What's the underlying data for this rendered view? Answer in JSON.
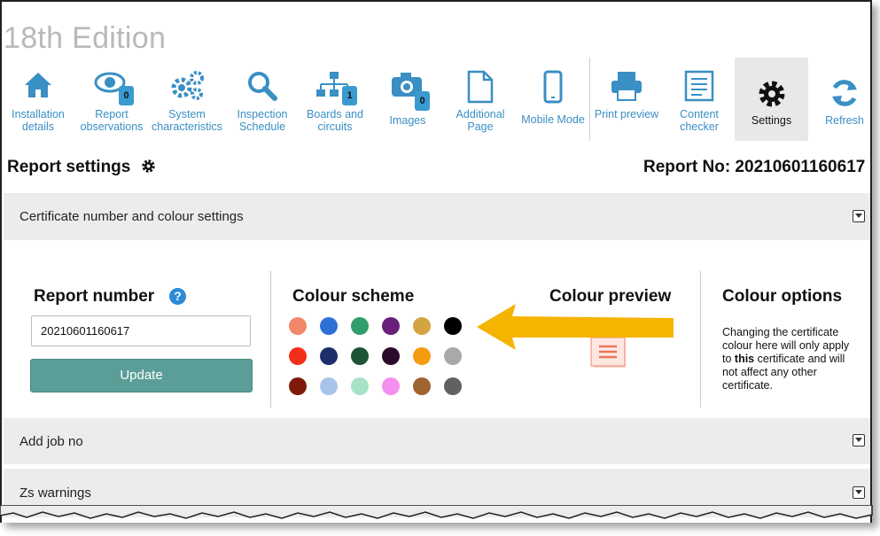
{
  "app": {
    "edition": "18th Edition"
  },
  "toolbar": {
    "items": [
      {
        "id": "installation",
        "label": "Installation details",
        "icon": "house-icon"
      },
      {
        "id": "observations",
        "label": "Report observations",
        "icon": "eye-icon",
        "badge": "0"
      },
      {
        "id": "system",
        "label": "System characteristics",
        "icon": "gears-icon"
      },
      {
        "id": "inspection",
        "label": "Inspection Schedule",
        "icon": "magnifier-icon"
      },
      {
        "id": "boards",
        "label": "Boards and circuits",
        "icon": "hierarchy-icon",
        "badge": "1"
      },
      {
        "id": "images",
        "label": "Images",
        "icon": "camera-icon",
        "badge": "0"
      },
      {
        "id": "additional",
        "label": "Additional Page",
        "icon": "page-icon"
      },
      {
        "id": "mobile",
        "label": "Mobile Mode",
        "icon": "phone-icon"
      },
      {
        "id": "print",
        "label": "Print preview",
        "icon": "printer-icon"
      },
      {
        "id": "checker",
        "label": "Content checker",
        "icon": "checklist-icon"
      },
      {
        "id": "settings",
        "label": "Settings",
        "icon": "gear-icon",
        "active": true
      },
      {
        "id": "refresh",
        "label": "Refresh",
        "icon": "refresh-icon"
      }
    ],
    "accent": "#3a8fc4",
    "badge_color": "#3a9bd0"
  },
  "header": {
    "title": "Report settings",
    "report_no_label": "Report No: 20210601160617"
  },
  "sections": {
    "certificate": "Certificate number and colour settings",
    "job_no": "Add job no",
    "zs_warnings": "Zs warnings"
  },
  "report_number": {
    "title": "Report number",
    "help": "?",
    "value": "20210601160617",
    "update_label": "Update",
    "button_color": "#5b9e98"
  },
  "colour_scheme": {
    "title": "Colour scheme",
    "swatches": [
      [
        "#f4876b",
        "#2e6fd6",
        "#2f9e6a",
        "#6a1f7a",
        "#d4a441",
        "#000000"
      ],
      [
        "#f2301a",
        "#1c2f6b",
        "#1d5535",
        "#2b0a2b",
        "#f59b12",
        "#a9a9a9"
      ],
      [
        "#7d1a0a",
        "#a9c4ec",
        "#a6e2c5",
        "#f58ff0",
        "#a0652f",
        "#616161"
      ]
    ]
  },
  "colour_preview": {
    "title": "Colour preview",
    "accent": "#f4876b"
  },
  "colour_options": {
    "title": "Colour options",
    "text_before": "Changing the certificate colour here will only apply to ",
    "text_bold": "this",
    "text_after": " certificate and will not affect any other certificate."
  },
  "annotation": {
    "arrow_color": "#f4b400"
  }
}
